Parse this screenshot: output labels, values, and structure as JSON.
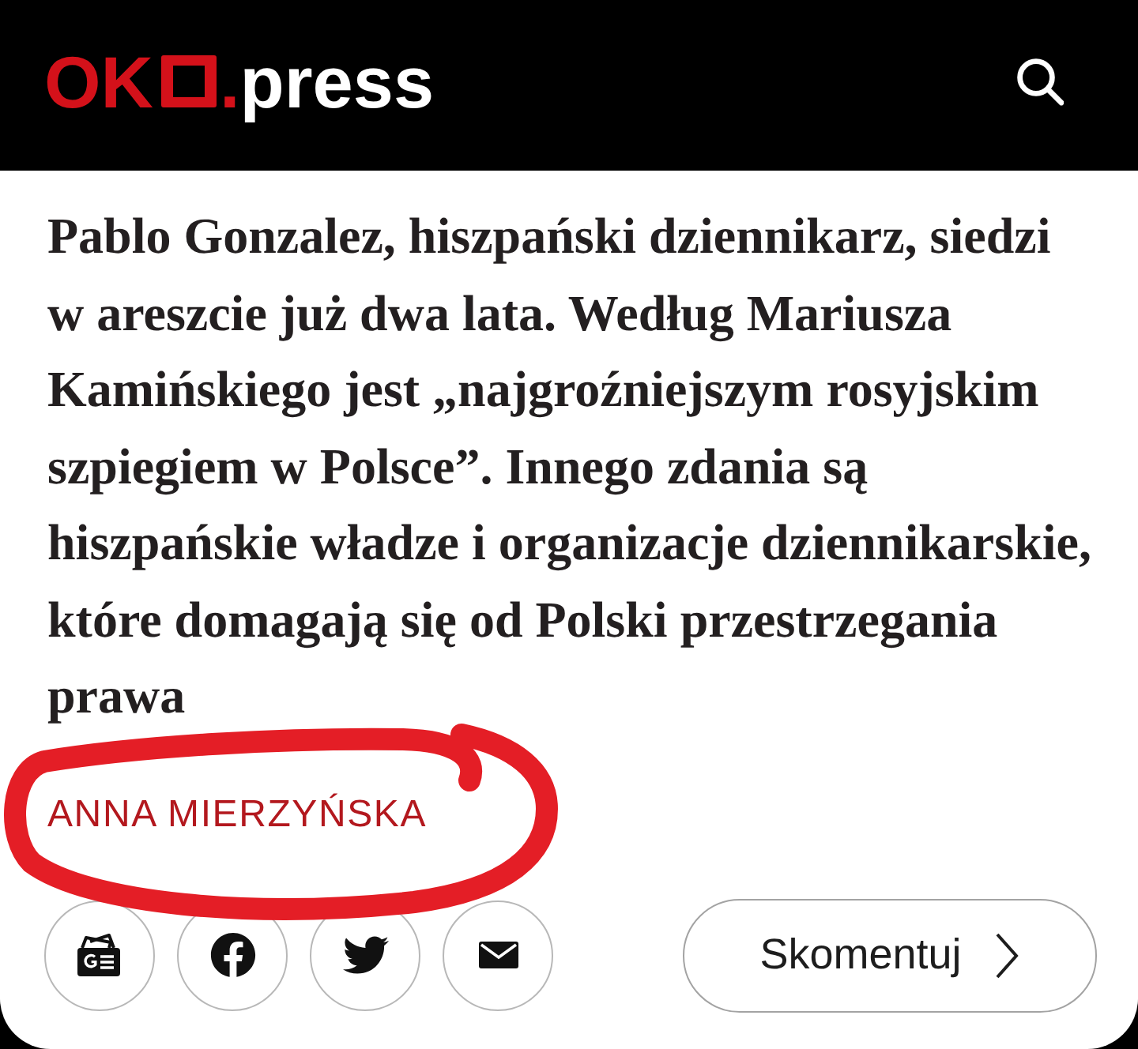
{
  "header": {
    "logo": {
      "initials": "OK",
      "dot": ".",
      "domain": "press"
    }
  },
  "article": {
    "lede": "Pablo Gonzalez, hiszpański dziennikarz, siedzi w areszcie już dwa lata. Według Mariusza Kamińskiego jest „najgroźniejszym rosyjskim szpiegiem w Polsce”. Innego zdania są hiszpańskie władze i organizacje dziennikarskie, które domagają się od Polski przestrzegania prawa",
    "author": "ANNA MIERZYŃSKA"
  },
  "comment_button": {
    "label": "Skomentuj"
  }
}
